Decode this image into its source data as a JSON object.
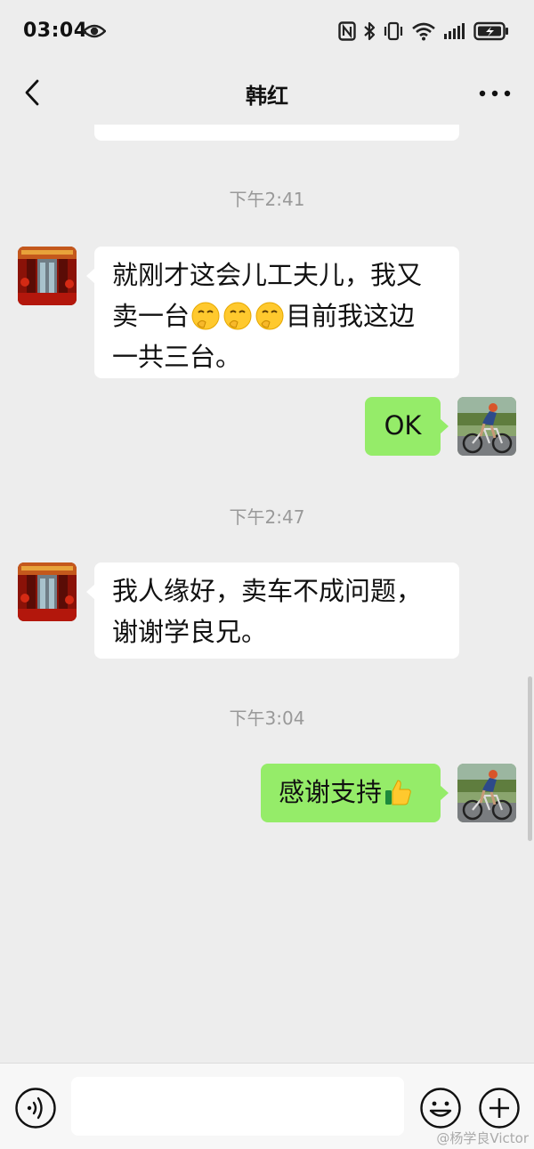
{
  "status_bar": {
    "time": "03:04",
    "icons": [
      "eye-icon",
      "nfc-icon",
      "bluetooth-icon",
      "vibrate-icon",
      "wifi-icon",
      "signal-icon",
      "battery-charging-icon"
    ]
  },
  "header": {
    "title": "韩红",
    "back_icon": "chevron-left-icon",
    "more_icon": "more-dots-icon"
  },
  "messages": [
    {
      "type": "timestamp",
      "text": "下午2:41"
    },
    {
      "type": "incoming",
      "text_parts": [
        "就刚才这会儿工夫儿，我又",
        "卖一台",
        "目前我这边",
        "一共三台。"
      ],
      "emoji": "shushing-face-icon",
      "emoji_count": 3
    },
    {
      "type": "outgoing",
      "text": "OK"
    },
    {
      "type": "timestamp",
      "text": "下午2:47"
    },
    {
      "type": "incoming",
      "text_parts": [
        "我人缘好，卖车不成问题，",
        "谢谢学良兄。"
      ]
    },
    {
      "type": "timestamp",
      "text": "下午3:04"
    },
    {
      "type": "outgoing",
      "text": "感谢支持",
      "emoji": "thumbs-up-icon"
    }
  ],
  "input_bar": {
    "voice_icon": "voice-icon",
    "emoji_icon": "smiley-icon",
    "plus_icon": "plus-icon",
    "placeholder": ""
  },
  "watermark": "@杨学良Victor",
  "colors": {
    "background": "#ededed",
    "incoming_bubble": "#ffffff",
    "outgoing_bubble": "#95ec69",
    "timestamp_text": "#999999",
    "input_bar": "#f7f7f7"
  }
}
